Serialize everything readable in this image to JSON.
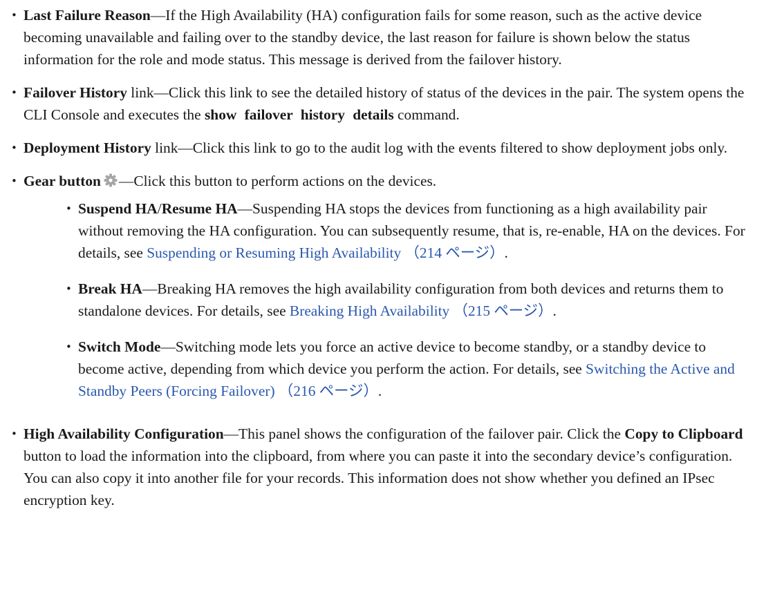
{
  "items": [
    {
      "title": "Last Failure Reason",
      "text": "—If the High Availability (HA) configuration fails for some reason, such as the active device becoming unavailable and failing over to the standby device, the last reason for failure is shown below the status information for the role and mode status. This message is derived from the failover history."
    },
    {
      "title": "Failover History",
      "text_pre": " link—Click this link to see the detailed history of status of the devices in the pair. The system opens the CLI Console and executes the ",
      "command": "show failover history details",
      "text_post": " command."
    },
    {
      "title": "Deployment History",
      "text": " link—Click this link to go to the audit log with the events filtered to show deployment jobs only."
    },
    {
      "title": "Gear button",
      "icon": "gear-icon",
      "text": "—Click this button to perform actions on the devices."
    },
    {
      "title": "High Availability Configuration",
      "text_pre": "—This panel shows the configuration of the failover pair. Click the ",
      "button_name": "Copy to Clipboard",
      "text_post": " button to load the information into the clipboard, from where you can paste it into the secondary device’s configuration. You can also copy it into another file for your records. This information does not show whether you defined an IPsec encryption key."
    }
  ],
  "gear_actions": [
    {
      "title": "Suspend HA",
      "sep": "/",
      "title2": "Resume HA",
      "text": "—Suspending HA stops the devices from functioning as a high availability pair without removing the HA configuration. You can subsequently resume, that is, re-enable, HA on the devices. For details, see ",
      "link": "Suspending or Resuming High Availability （214 ページ）",
      "end": "."
    },
    {
      "title": "Break HA",
      "text": "—Breaking HA removes the high availability configuration from both devices and returns them to standalone devices. For details, see ",
      "link": "Breaking High Availability （215 ページ）",
      "end": "."
    },
    {
      "title": "Switch Mode",
      "text": "—Switching mode lets you force an active device to become standby, or a standby device to become active, depending from which device you perform the action. For details, see ",
      "link": "Switching the Active and Standby Peers (Forcing Failover) （216 ページ）",
      "end": "."
    }
  ],
  "colors": {
    "link": "#2a58ad",
    "gear": "#a6a6a6",
    "text": "#1a1a1a"
  }
}
